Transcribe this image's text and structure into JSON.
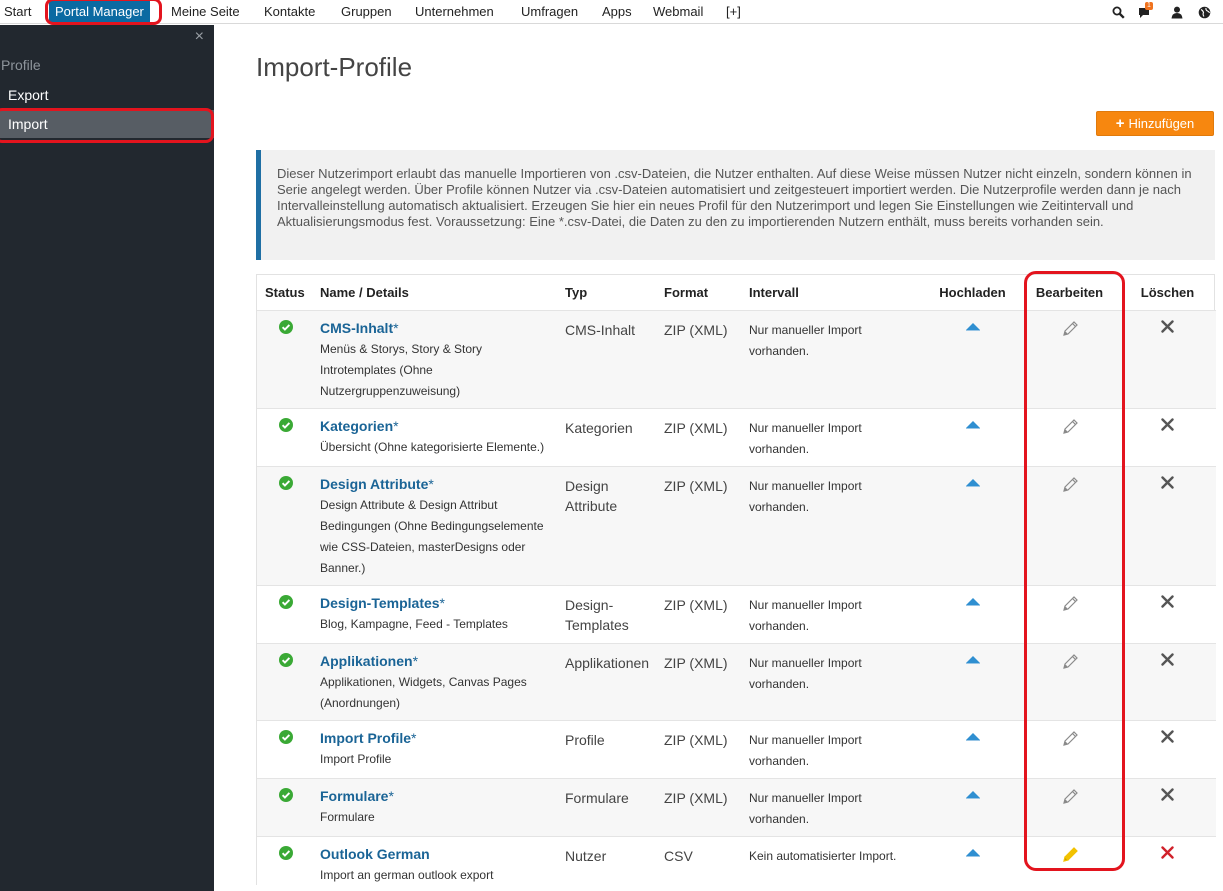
{
  "topnav": {
    "items": [
      "Start",
      "Portal Manager",
      "Meine Seite",
      "Kontakte",
      "Gruppen",
      "Unternehmen",
      "Umfragen",
      "Apps",
      "Webmail",
      "[+]"
    ],
    "notification_count": "1"
  },
  "sidebar": {
    "close": "×",
    "heading": "Profile",
    "items": [
      {
        "label": "Export"
      },
      {
        "label": "Import"
      }
    ]
  },
  "main": {
    "title": "Import-Profile",
    "add_button": "Hinzufügen",
    "info": "Dieser Nutzerimport erlaubt das manuelle Importieren von .csv-Dateien, die Nutzer enthalten. Auf diese Weise müssen Nutzer nicht einzeln, sondern können in Serie angelegt werden. Über Profile können Nutzer via .csv-Dateien automatisiert und zeitgesteuert importiert werden. Die Nutzerprofile werden dann je nach Intervalleinstellung automatisch aktualisiert. Erzeugen Sie hier ein neues Profil für den Nutzerimport und legen Sie Einstellungen wie Zeitintervall und Aktualisierungsmodus fest. Voraussetzung: Eine *.csv-Datei, die Daten zu den zu importierenden Nutzern enthält, muss bereits vorhanden sein."
  },
  "table": {
    "headers": {
      "status": "Status",
      "name": "Name / Details",
      "typ": "Typ",
      "format": "Format",
      "intervall": "Intervall",
      "upload": "Hochladen",
      "edit": "Bearbeiten",
      "delete": "Löschen"
    },
    "rows": [
      {
        "name": "CMS-Inhalt",
        "star": "*",
        "details": "Menüs & Storys, Story & Story Introtemplates (Ohne Nutzergruppenzuweisung)",
        "typ": "CMS-Inhalt",
        "format": "ZIP (XML)",
        "intervall": "Nur manueller Import vorhanden."
      },
      {
        "name": "Kategorien",
        "star": "*",
        "details": "Übersicht (Ohne kategorisierte Elemente.)",
        "typ": "Kategorien",
        "format": "ZIP (XML)",
        "intervall": "Nur manueller Import vorhanden."
      },
      {
        "name": "Design Attribute",
        "star": "*",
        "details": "Design Attribute & Design Attribut Bedingungen (Ohne Bedingungselemente wie CSS-Dateien, masterDesigns oder Banner.)",
        "typ": "Design Attribute",
        "format": "ZIP (XML)",
        "intervall": "Nur manueller Import vorhanden."
      },
      {
        "name": "Design-Templates",
        "star": "*",
        "details": "Blog, Kampagne, Feed - Templates",
        "typ": "Design-Templates",
        "format": "ZIP (XML)",
        "intervall": "Nur manueller Import vorhanden."
      },
      {
        "name": "Applikationen",
        "star": "*",
        "details": "Applikationen, Widgets, Canvas Pages (Anordnungen)",
        "typ": "Applikationen",
        "format": "ZIP (XML)",
        "intervall": "Nur manueller Import vorhanden."
      },
      {
        "name": "Import Profile",
        "star": "*",
        "details": "Import Profile",
        "typ": "Profile",
        "format": "ZIP (XML)",
        "intervall": "Nur manueller Import vorhanden."
      },
      {
        "name": "Formulare",
        "star": "*",
        "details": "Formulare",
        "typ": "Formulare",
        "format": "ZIP (XML)",
        "intervall": "Nur manueller Import vorhanden."
      },
      {
        "name": "Outlook German",
        "star": "",
        "details": "Import an german outlook export",
        "typ": "Nutzer",
        "format": "CSV",
        "intervall": "Kein automatisierter Import."
      }
    ]
  },
  "colors": {
    "nav_active": "#0b6aa2",
    "sidebar_bg": "#22282f",
    "accent_orange": "#f7870f",
    "link_blue": "#1a6496",
    "status_green": "#3aa935",
    "highlight_red": "#e3141e",
    "delete_red": "#d0212a",
    "edit_yellow": "#f2c200"
  },
  "icons": {
    "status": "check-circle-icon",
    "upload": "upload-triangle-icon",
    "edit": "pencil-icon",
    "delete": "close-x-icon"
  }
}
